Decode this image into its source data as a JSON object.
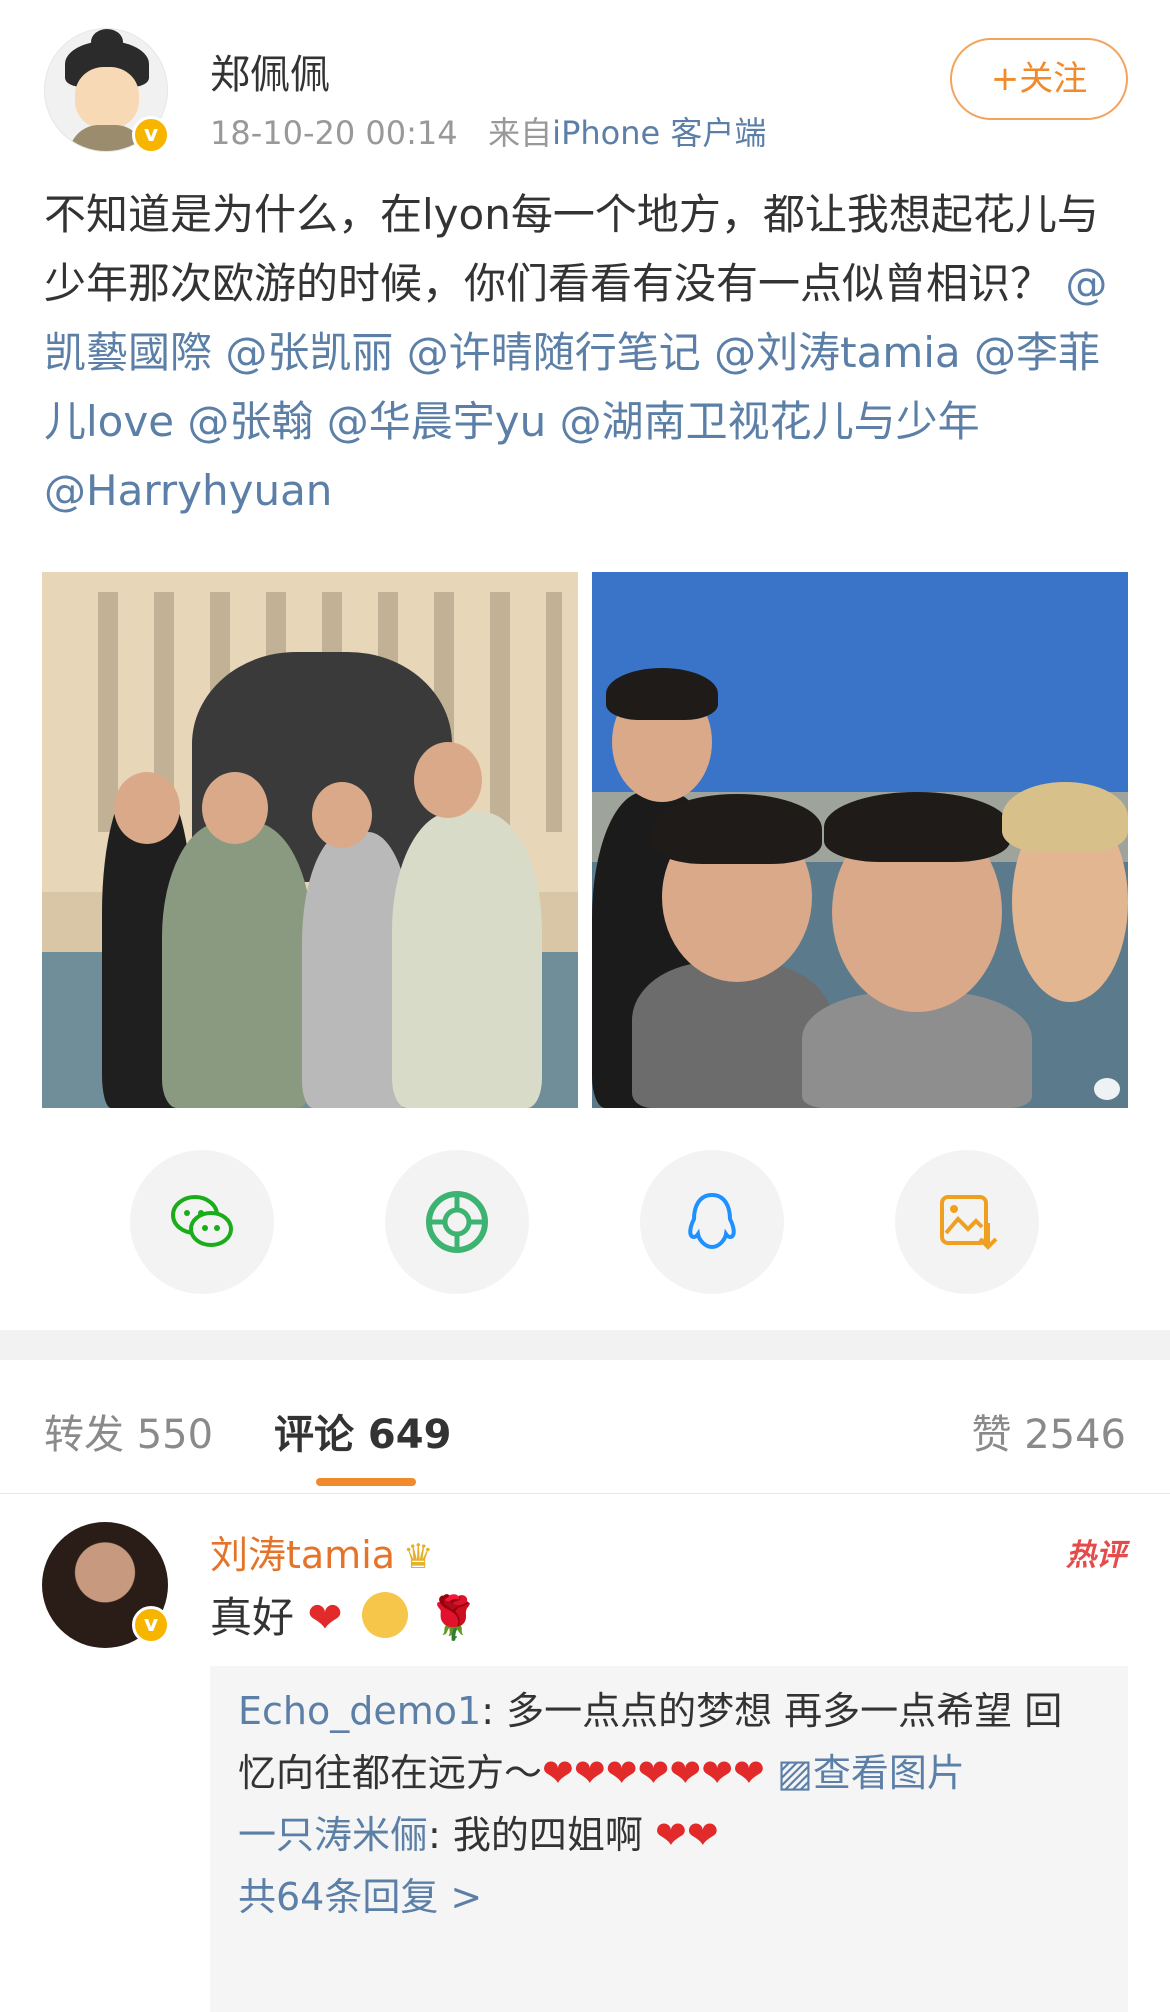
{
  "post": {
    "author": "郑佩佩",
    "time": "18-10-20 00:14",
    "from_prefix": "来自",
    "source": "iPhone 客户端",
    "follow_label": "+关注",
    "text_plain": "不知道是为什么，在lyon每一个地方，都让我想起花儿与少年那次欧游的时候，你们看看有没有一点似曾相识？",
    "mentions": [
      "@凯藝國際",
      "@张凯丽",
      "@许晴随行笔记",
      "@刘涛tamia",
      "@李菲儿love",
      "@张翰",
      "@华晨宇yu",
      "@湖南卫视花儿与少年",
      "@Harryhyuan"
    ]
  },
  "share": {
    "icons": [
      "wechat-icon",
      "moments-icon",
      "qq-icon",
      "save-image-icon"
    ],
    "colors": {
      "wechat": "#1aad19",
      "moments": "#3cb371",
      "qq": "#1e90ff",
      "save": "#f0a020"
    }
  },
  "tabs": {
    "repost": "转发 550",
    "comment": "评论 649",
    "like": "赞 2546"
  },
  "comment": {
    "user": "刘涛tamia",
    "hot": "热评",
    "text": "真好",
    "replies": [
      {
        "user": "Echo_demo1",
        "text": "多一点点的梦想 再多一点希望 回忆向往都在远方～",
        "hearts": "❤❤❤❤❤❤❤",
        "link": "查看图片"
      },
      {
        "user": "一只涛米俪",
        "text": "我的四姐啊",
        "hearts": "❤❤"
      }
    ],
    "total": "共64条回复 >"
  },
  "colors": {
    "accent": "#f08a2b",
    "link": "#5b7fa6",
    "text": "#333333",
    "muted": "#999999"
  }
}
